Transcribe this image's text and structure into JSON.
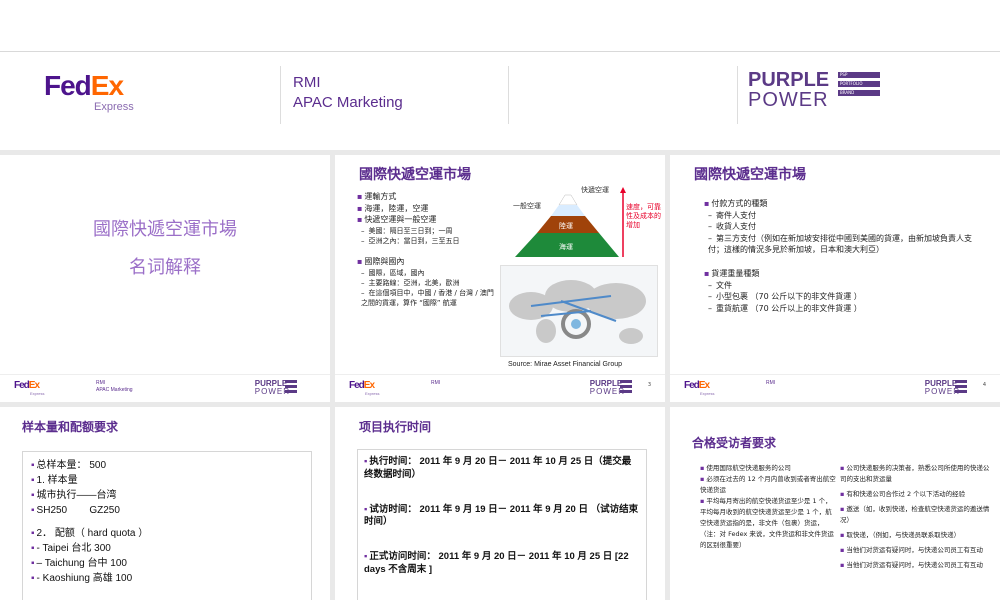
{
  "header": {
    "fedex_fe": "Fed",
    "fedex_ex": "Ex",
    "express": "Express",
    "rmi": "RMI",
    "apac": "APAC Marketing",
    "purple": "PURPLE",
    "power": "POWER",
    "pp_tags": [
      "PSP",
      "PORTFOLIO",
      "BRAND"
    ]
  },
  "slide1": {
    "title": "國際快遞空運市場",
    "subtitle": "名词解释",
    "footer": {
      "rmi": "RMI",
      "apac": "APAC Marketing"
    }
  },
  "slide2": {
    "title": "國際快遞空運市場",
    "bullets": [
      "運輸方式",
      "海運，陸運，空運",
      "快遞空運與一般空運"
    ],
    "sub_a": [
      "美國：隔日至三日到；一周",
      "亞洲之內：當日到，三至五日"
    ],
    "bullet2": "國際與國內",
    "sub_b": [
      "國際，區域，國內",
      "主要路線：亞洲，北美，歐洲",
      "在這個項目中，中國 / 香港 / 台灣 / 澳門之間的貨運，算作 “國際” 航運"
    ],
    "pyramid": {
      "express_air": "快遞空運",
      "general_air": "一般空運",
      "land": "陸運",
      "sea": "海運"
    },
    "arrow_note": "速度，可靠性及成本的增加",
    "source": "Source: Mirae Asset Financial Group",
    "footer": {
      "rmi": "RMI"
    },
    "page": "3"
  },
  "slide3": {
    "title": "國際快遞空運市場",
    "bullet1": "付款方式的種類",
    "sub1": [
      "寄件人支付",
      "收貨人支付",
      "第三方支付（例如在新加坡安排從中國到美國的貨運，由新加坡負責人支付；這樣的情況多見於新加坡，日本和澳大利亞）"
    ],
    "bullet2": "貨運重量種類",
    "sub2": [
      "文件",
      "小型包裹 （70 公斤以下的非文件貨運 ）",
      "重貨航運 （70 公斤以上的非文件貨運 ）"
    ],
    "footer": {
      "rmi": "RMI"
    },
    "page": "4"
  },
  "slide4": {
    "title": "样本量和配额要求",
    "lines": [
      "总样本量： 500",
      "1. 样本量",
      "城市执行——台湾",
      "SH250        GZ250",
      "",
      "2． 配额（ hard quota ）",
      "- Taipei  台北 300",
      "– Taichung  台中 100",
      "- Kaoshiung  高雄 100"
    ]
  },
  "slide5": {
    "title": "项目执行时间",
    "items": [
      "执行时间： 2011 年 9 月 20 日－ 2011 年 10 月 25 日（提交最终数据时间）",
      "试访时间： 2011 年 9 月 19 日－ 2011 年 9 月 20 日 （试访结束时间）",
      "正式访问时间： 2011 年 9 月 20 日－ 2011 年 10 月 25 日 [22 days 不含周末 ]"
    ]
  },
  "slide6": {
    "title": "合格受访者要求",
    "left": [
      "使用国际航空快递服务的公司",
      "必须在过去的 12 个月内曾收到或者寄出航空快递货运",
      "平均每月寄出的航空快递货运至少是 1 个，平均每月收到的航空快递货运至少是 1 个，航空快递货运指的是，非文件（包裹）货运，（注：对 Fedex 来说，文件货运和非文件货运的区别很重要）"
    ],
    "right": [
      "公司快递服务的决策者，熟悉公司所使用的快递公司的支出和货运量",
      "有和快递公司合作过 2 个以下活动的经验",
      "邀送（如，收到快递，检查航空快递货运的邀送情况）",
      "取快递，（例如，与快递员联系取快递）",
      "当他们对货运有疑问时，与快递公司员工有互动",
      "当他们对货运有疑问时，与快递公司员工有互动"
    ]
  },
  "colors": {
    "purple": "#5b2d8e",
    "orange": "#ff6600",
    "accent_red": "#e8002a"
  }
}
